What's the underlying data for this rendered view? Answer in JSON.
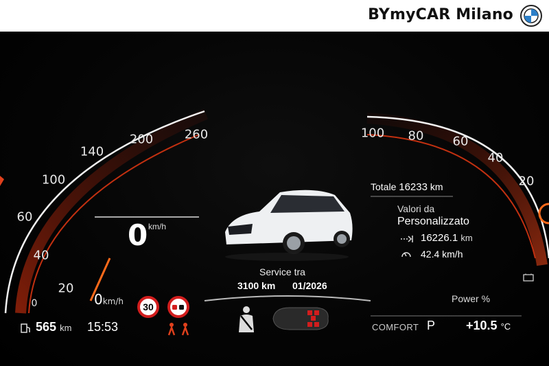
{
  "header": {
    "brand": "BYmyCAR Milano",
    "logo_icon": "bmw-roundel-icon"
  },
  "speedometer": {
    "ticks": [
      "20",
      "40",
      "60",
      "100",
      "140",
      "200",
      "260"
    ],
    "zero_tick": "0",
    "current_speed": "0",
    "unit": "km/h",
    "lower_speed": "0",
    "lower_unit": "km/h"
  },
  "left_status": {
    "range_value": "565",
    "range_unit": "km",
    "clock": "15:53",
    "fuel_icon": "fuel-pump-icon"
  },
  "traffic_signs": {
    "speed_limit": "30",
    "no_overtaking_icon": "no-overtaking-icon",
    "driver_assist_icon": "lane-assist-icon"
  },
  "center": {
    "car_icon": "car-icon",
    "service_title": "Service tra",
    "service_km": "3100 km",
    "service_date": "01/2026",
    "seatbelt_icon": "seatbelt-icon",
    "car_topview_icon": "car-topview-icon"
  },
  "trip_info": {
    "totale_label": "Totale",
    "totale_value": "16233",
    "totale_unit": "km",
    "valori_label": "Valori da",
    "mode": "Personalizzato",
    "trip_value": "16226.1",
    "trip_unit": "km",
    "avg_value": "42.4",
    "avg_unit": "km/h"
  },
  "power_gauge": {
    "ticks": [
      "100",
      "80",
      "60",
      "40",
      "20"
    ],
    "label": "Power %",
    "battery_icon": "battery-icon"
  },
  "bottom_right": {
    "mode": "COMFORT",
    "gear": "P",
    "temperature": "+10.5",
    "temp_unit": "°C"
  },
  "colors": {
    "accent_red": "#e0401c",
    "background": "#000000",
    "text": "#ffffff"
  }
}
